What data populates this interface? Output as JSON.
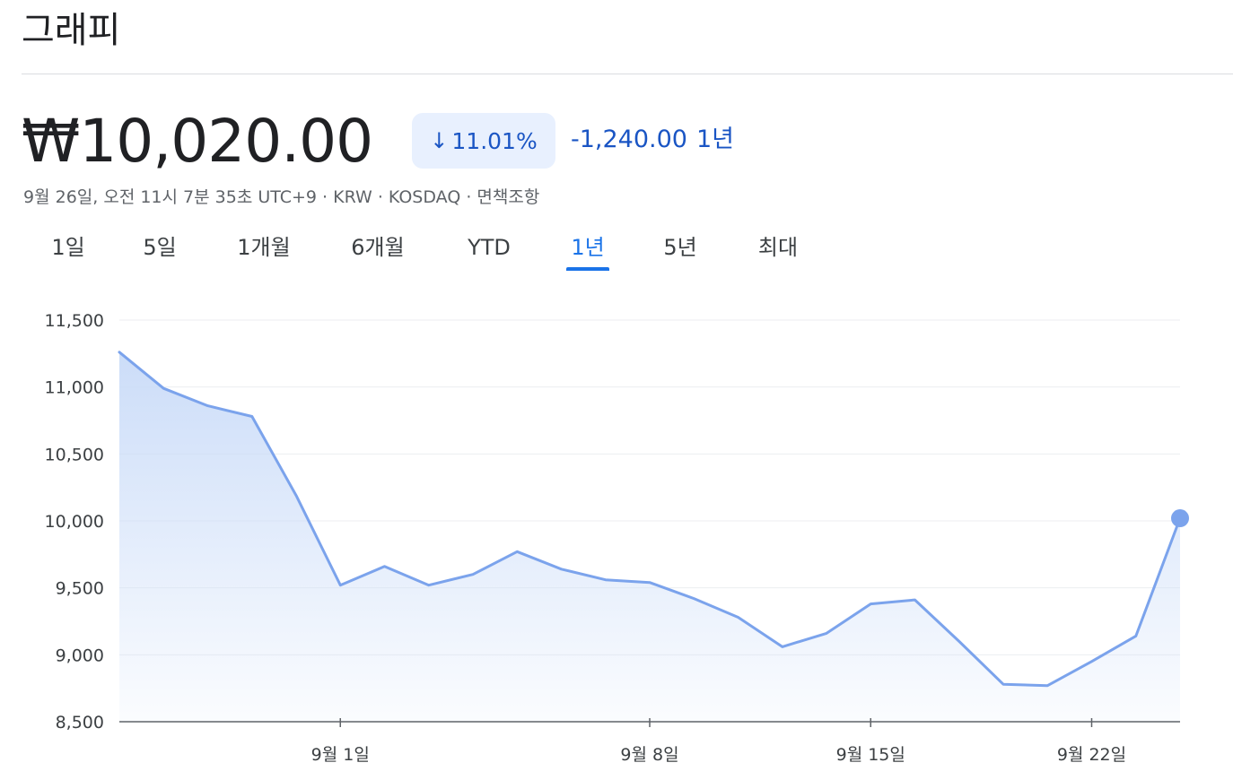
{
  "header": {
    "title": "그래피"
  },
  "quote": {
    "price": "₩10,020.00",
    "change_pct": "11.01%",
    "direction_icon": "arrow-down-icon",
    "change_abs": "-1,240.00",
    "change_period": "1년",
    "meta": "9월 26일, 오전 11시 7분 35초 UTC+9 · KRW · KOSDAQ · 면책조항"
  },
  "tabs": [
    {
      "label": "1일",
      "active": false
    },
    {
      "label": "5일",
      "active": false
    },
    {
      "label": "1개월",
      "active": false
    },
    {
      "label": "6개월",
      "active": false
    },
    {
      "label": "YTD",
      "active": false
    },
    {
      "label": "1년",
      "active": true
    },
    {
      "label": "5년",
      "active": false
    },
    {
      "label": "최대",
      "active": false
    }
  ],
  "colors": {
    "line": "#7ba3ec",
    "accent": "#1a73e8",
    "negative": "#1a55c4"
  },
  "chart_data": {
    "type": "area",
    "x": [
      "8월 26일",
      "8월 27일",
      "8월 28일",
      "8월 29일",
      "8월 30일",
      "9월 1일",
      "9월 2일",
      "9월 3일",
      "9월 4일",
      "9월 5일",
      "9월 6일",
      "9월 7일",
      "9월 8일",
      "9월 9일",
      "9월 10일",
      "9월 11일",
      "9월 12일",
      "9월 15일",
      "9월 16일",
      "9월 17일",
      "9월 18일",
      "9월 19일",
      "9월 22일",
      "9월 23일",
      "9월 24일",
      "9월 25일",
      "9월 26일"
    ],
    "values": [
      11260,
      10990,
      10860,
      10780,
      10190,
      9520,
      9660,
      9520,
      9600,
      9770,
      9640,
      9560,
      9540,
      9420,
      9280,
      9060,
      9160,
      9380,
      9410,
      9100,
      8780,
      8770,
      8950,
      9140,
      10020
    ],
    "xticks": [
      "9월 1일",
      "9월 8일",
      "9월 15일",
      "9월 22일"
    ],
    "ylim": [
      8500,
      11500
    ],
    "yticks": [
      "11,500",
      "11,000",
      "10,500",
      "10,000",
      "9,500",
      "9,000",
      "8,500"
    ],
    "grid": true
  }
}
